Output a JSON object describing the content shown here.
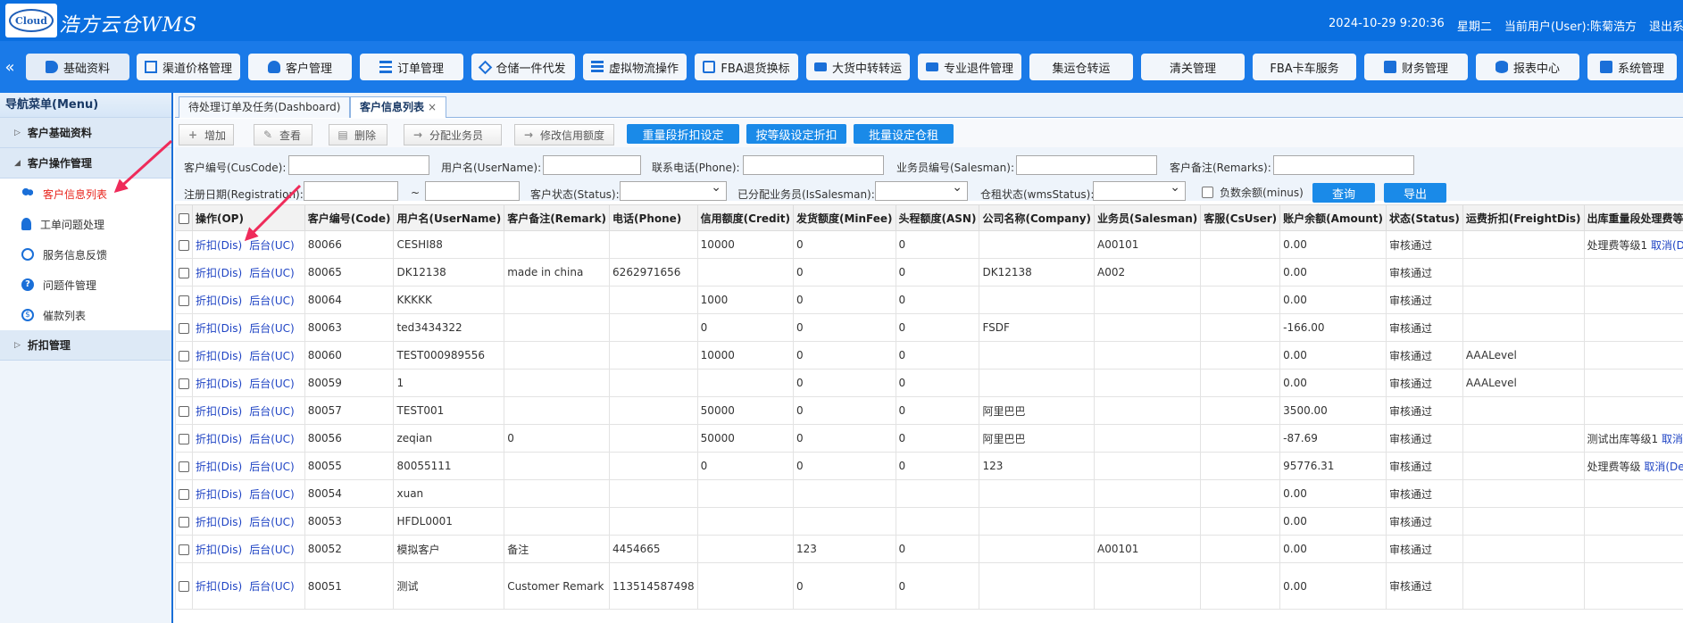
{
  "header": {
    "logo_text": "Cloud",
    "brand": "浩方云仓WMS",
    "datetime": "2024-10-29 9:20:36",
    "weekday": "星期二",
    "current_user": "当前用户(User):陈菊浩方",
    "logout": "退出系统"
  },
  "nav": {
    "collapse": "«",
    "items": [
      {
        "label": "基础资料",
        "icon": "tag-icon"
      },
      {
        "label": "渠道价格管理",
        "icon": "chart-icon"
      },
      {
        "label": "客户管理",
        "icon": "user-icon"
      },
      {
        "label": "订单管理",
        "icon": "list-icon"
      },
      {
        "label": "仓储一件代发",
        "icon": "cube-icon"
      },
      {
        "label": "虚拟物流操作",
        "icon": "grid-icon"
      },
      {
        "label": "FBA退货换标",
        "icon": "box-icon"
      },
      {
        "label": "大货中转转运",
        "icon": "truck-icon"
      },
      {
        "label": "专业退件管理",
        "icon": "truck-icon"
      },
      {
        "label": "集运仓转运",
        "icon": ""
      },
      {
        "label": "清关管理",
        "icon": ""
      },
      {
        "label": "FBA卡车服务",
        "icon": ""
      },
      {
        "label": "财务管理",
        "icon": "gear-icon"
      },
      {
        "label": "报表中心",
        "icon": "database-icon"
      },
      {
        "label": "系统管理",
        "icon": "gear-icon"
      }
    ]
  },
  "sidebar": {
    "title": "导航菜单(Menu)",
    "groups": [
      {
        "label": "客户基础资料"
      },
      {
        "label": "客户操作管理"
      },
      {
        "label": "折扣管理"
      }
    ],
    "subitems": [
      {
        "label": "客户信息列表",
        "icon": "users-icon"
      },
      {
        "label": "工单问题处理",
        "icon": "person-icon"
      },
      {
        "label": "服务信息反馈",
        "icon": "chat-icon"
      },
      {
        "label": "问题件管理",
        "icon": "question-icon"
      },
      {
        "label": "催款列表",
        "icon": "coin-icon"
      }
    ]
  },
  "tabs": [
    {
      "label": "待处理订单及任务(Dashboard)"
    },
    {
      "label": "客户信息列表",
      "close": "×"
    }
  ],
  "toolbar": {
    "add": "增加",
    "view": "查看",
    "delete": "删除",
    "assign": "分配业务员",
    "credit": "修改信用额度",
    "weight_discount": "重量段折扣设定",
    "level_discount": "按等级设定折扣",
    "batch_rent": "批量设定仓租",
    "add_icon": "+",
    "view_icon": "✎",
    "delete_icon": "▤",
    "assign_icon": "→",
    "credit_icon": "→"
  },
  "filters": {
    "cuscode": "客户编号(CusCode):",
    "username": "用户名(UserName):",
    "phone": "联系电话(Phone):",
    "salesman": "业务员编号(Salesman):",
    "remarks": "客户备注(Remarks):",
    "registration": "注册日期(Registration):",
    "tilde": "~",
    "status": "客户状态(Status):",
    "is_salesman": "已分配业务员(IsSalesman):",
    "wms_status": "仓租状态(wmsStatus):",
    "minus": "负数余额(minus)",
    "query": "查询",
    "export": "导出"
  },
  "table": {
    "headers": [
      "操作(OP)",
      "客户编号(Code)",
      "用户名(UserName)",
      "客户备注(Remark)",
      "电话(Phone)",
      "信用额度(Credit)",
      "发货额度(MinFee)",
      "头程额度(ASN)",
      "公司名称(Company)",
      "业务员(Salesman)",
      "客服(CsUser)",
      "账户余额(Amount)",
      "状态(Status)",
      "运费折扣(FreightDis)",
      "出库重量段处理费等级(OutProc"
    ],
    "op_dis": "折扣(Dis)",
    "op_uc": "后台(UC)",
    "cancel": "取消(Del)",
    "rows": [
      {
        "code": "80066",
        "user": "CESHI88",
        "remark": "",
        "phone": "",
        "credit": "10000",
        "minfee": "0",
        "asn": "0",
        "company": "",
        "sales": "A00101",
        "cs": "",
        "amount": "0.00",
        "status": "审核通过",
        "freight": "",
        "outproc": "处理费等级1"
      },
      {
        "code": "80065",
        "user": "DK12138",
        "remark": "made in china",
        "phone": "6262971656",
        "credit": "",
        "minfee": "0",
        "asn": "0",
        "company": "DK12138",
        "sales": "A002",
        "cs": "",
        "amount": "0.00",
        "status": "审核通过",
        "freight": "",
        "outproc": ""
      },
      {
        "code": "80064",
        "user": "KKKKK",
        "remark": "",
        "phone": "",
        "credit": "1000",
        "minfee": "0",
        "asn": "0",
        "company": "",
        "sales": "",
        "cs": "",
        "amount": "0.00",
        "status": "审核通过",
        "freight": "",
        "outproc": ""
      },
      {
        "code": "80063",
        "user": "ted3434322",
        "remark": "",
        "phone": "",
        "credit": "0",
        "minfee": "0",
        "asn": "0",
        "company": "FSDF",
        "sales": "",
        "cs": "",
        "amount": "-166.00",
        "status": "审核通过",
        "freight": "",
        "outproc": ""
      },
      {
        "code": "80060",
        "user": "TEST000989556",
        "remark": "",
        "phone": "",
        "credit": "10000",
        "minfee": "0",
        "asn": "0",
        "company": "",
        "sales": "",
        "cs": "",
        "amount": "0.00",
        "status": "审核通过",
        "freight": "AAALevel",
        "outproc": ""
      },
      {
        "code": "80059",
        "user": "1",
        "remark": "",
        "phone": "",
        "credit": "",
        "minfee": "0",
        "asn": "0",
        "company": "",
        "sales": "",
        "cs": "",
        "amount": "0.00",
        "status": "审核通过",
        "freight": "AAALevel",
        "outproc": ""
      },
      {
        "code": "80057",
        "user": "TEST001",
        "remark": "",
        "phone": "",
        "credit": "50000",
        "minfee": "0",
        "asn": "0",
        "company": "阿里巴巴",
        "sales": "",
        "cs": "",
        "amount": "3500.00",
        "status": "审核通过",
        "freight": "",
        "outproc": ""
      },
      {
        "code": "80056",
        "user": "zeqian",
        "remark": "0",
        "phone": "",
        "credit": "50000",
        "minfee": "0",
        "asn": "0",
        "company": "阿里巴巴",
        "sales": "",
        "cs": "",
        "amount": "-87.69",
        "status": "审核通过",
        "freight": "",
        "outproc": "测试出库等级1"
      },
      {
        "code": "80055",
        "user": "80055111",
        "remark": "",
        "phone": "",
        "credit": "0",
        "minfee": "0",
        "asn": "0",
        "company": "123",
        "sales": "",
        "cs": "",
        "amount": "95776.31",
        "status": "审核通过",
        "freight": "",
        "outproc": "处理费等级"
      },
      {
        "code": "80054",
        "user": "xuan",
        "remark": "",
        "phone": "",
        "credit": "",
        "minfee": "",
        "asn": "",
        "company": "",
        "sales": "",
        "cs": "",
        "amount": "0.00",
        "status": "审核通过",
        "freight": "",
        "outproc": ""
      },
      {
        "code": "80053",
        "user": "HFDL0001",
        "remark": "",
        "phone": "",
        "credit": "",
        "minfee": "",
        "asn": "",
        "company": "",
        "sales": "",
        "cs": "",
        "amount": "0.00",
        "status": "审核通过",
        "freight": "",
        "outproc": ""
      },
      {
        "code": "80052",
        "user": "模拟客户",
        "remark": "备注",
        "phone": "4454665",
        "credit": "",
        "minfee": "123",
        "asn": "0",
        "company": "",
        "sales": "A00101",
        "cs": "",
        "amount": "0.00",
        "status": "审核通过",
        "freight": "",
        "outproc": ""
      },
      {
        "code": "80051",
        "user": "测试",
        "remark": "Customer Remark",
        "phone": "113514587498",
        "credit": "",
        "minfee": "0",
        "asn": "0",
        "company": "",
        "sales": "",
        "cs": "",
        "amount": "0.00",
        "status": "审核通过",
        "freight": "",
        "outproc": ""
      }
    ]
  },
  "colors": {
    "header": "#0a6fe0",
    "navbar": "#1a7ae8",
    "button": "#1a8ae8",
    "link": "#1f44c4",
    "active": "#e8241c"
  }
}
